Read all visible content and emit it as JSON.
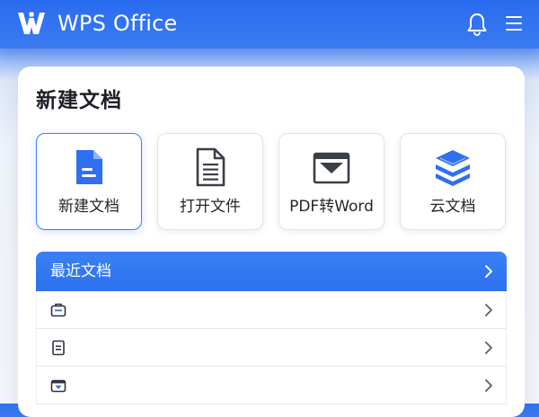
{
  "header": {
    "brand": "WPS Office",
    "logo_icon": "wps-logo-icon",
    "notification_icon": "bell-icon",
    "menu_icon": "hamburger-menu-icon",
    "colors": {
      "bar": "#2f72f0",
      "text": "#ffffff"
    }
  },
  "new_doc": {
    "title": "新建文档",
    "tiles": [
      {
        "label": "新建文档",
        "icon": "new-document-icon",
        "selected": true
      },
      {
        "label": "打开文件",
        "icon": "open-file-icon",
        "selected": false
      },
      {
        "label": "PDF转Word",
        "icon": "pdf-to-word-icon",
        "selected": false
      },
      {
        "label": "云文档",
        "icon": "cloud-docs-icon",
        "selected": false
      }
    ]
  },
  "recent": {
    "title": "最近文档",
    "header_icon": "chevron-right-icon",
    "items": [
      {
        "icon": "briefcase-doc-icon"
      },
      {
        "icon": "text-doc-icon"
      },
      {
        "icon": "shared-doc-icon"
      }
    ]
  },
  "colors": {
    "accent": "#3a7af2",
    "card": "#ffffff",
    "page": "#eef2f9"
  }
}
